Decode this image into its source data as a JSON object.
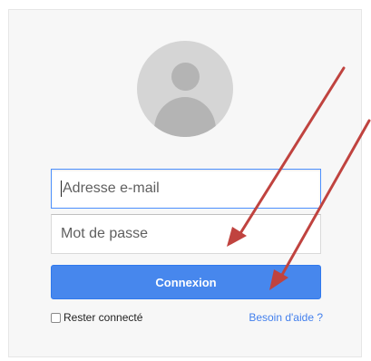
{
  "login": {
    "email_placeholder": "Adresse e-mail",
    "password_placeholder": "Mot de passe",
    "submit_label": "Connexion",
    "remember_label": "Rester connecté",
    "remember_checked": false,
    "help_link": "Besoin d'aide ?"
  },
  "colors": {
    "button": "#4787ed",
    "focus_border": "#4d90fe",
    "link": "#427fed",
    "arrow": "#c0433f"
  },
  "icons": {
    "avatar": "user-silhouette-icon",
    "annotation": "red-arrow"
  }
}
